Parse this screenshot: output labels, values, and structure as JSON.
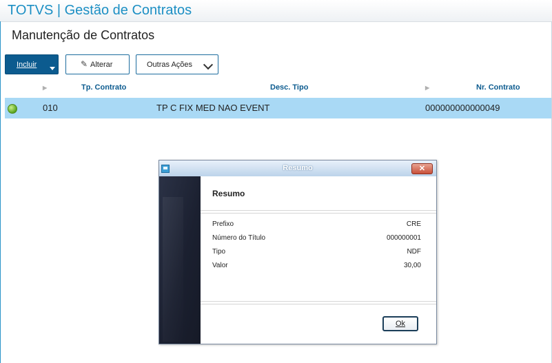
{
  "app": {
    "title": "TOTVS | Gestão de Contratos"
  },
  "page": {
    "title": "Manutenção de Contratos"
  },
  "toolbar": {
    "incluir_label": "Incluir",
    "alterar_label": "Alterar",
    "outras_acoes_label": "Outras Ações"
  },
  "grid": {
    "columns": [
      "Tp. Contrato",
      "Desc. Tipo",
      "Nr. Contrato"
    ],
    "rows": [
      {
        "status": "green",
        "tp_contrato": "010",
        "desc_tipo": "TP C FIX MED NAO EVENT",
        "nr_contrato": "000000000000049"
      }
    ]
  },
  "dialog": {
    "title": "Resumo",
    "close_glyph": "✕",
    "section_title": "Resumo",
    "fields": [
      {
        "label": "Prefixo",
        "value": "CRE"
      },
      {
        "label": "Número do Título",
        "value": "000000001"
      },
      {
        "label": "Tipo",
        "value": "NDF"
      },
      {
        "label": "Valor",
        "value": "30,00"
      }
    ],
    "ok_label": "Ok"
  },
  "colors": {
    "accent": "#1c8fc4",
    "primary_button": "#0c5b8f",
    "selected_row": "#a9d9f5",
    "status_active": "#5aa51f"
  },
  "icons": {
    "edit": "pencil-icon",
    "dropdown": "chevron-down-icon",
    "split_caret": "caret-down-icon",
    "status": "status-green-icon",
    "close": "close-icon"
  }
}
